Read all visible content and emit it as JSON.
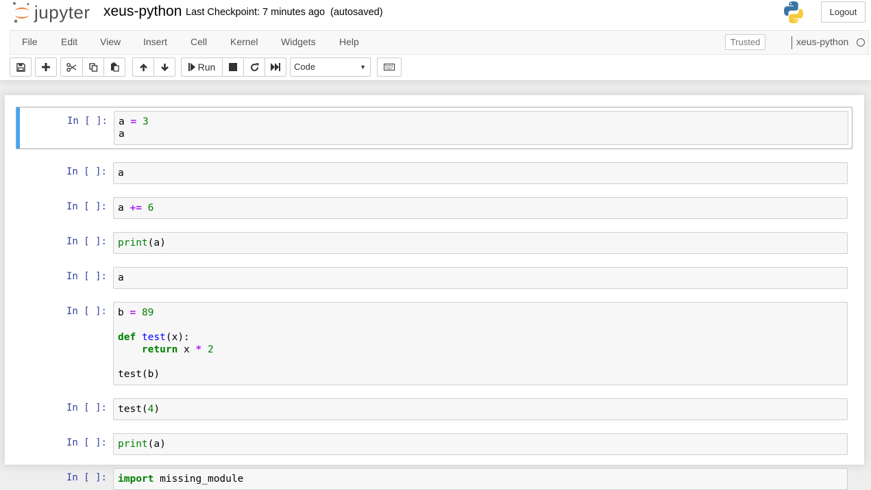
{
  "header": {
    "logo_text": "jupyter",
    "notebook_name": "xeus-python",
    "checkpoint": "Last Checkpoint: 7 minutes ago",
    "autosave": "(autosaved)",
    "logout_label": "Logout"
  },
  "menubar": {
    "items": [
      "File",
      "Edit",
      "View",
      "Insert",
      "Cell",
      "Kernel",
      "Widgets",
      "Help"
    ],
    "trusted_label": "Trusted",
    "kernel_name": "xeus-python"
  },
  "toolbar": {
    "run_label": "Run",
    "cell_type": "Code"
  },
  "cells": [
    {
      "prompt": "In [ ]:",
      "lines": [
        "a = 3",
        "a"
      ],
      "selected": true
    },
    {
      "prompt": "In [ ]:",
      "lines": [
        "a"
      ]
    },
    {
      "prompt": "In [ ]:",
      "lines": [
        "a += 6"
      ]
    },
    {
      "prompt": "In [ ]:",
      "lines": [
        "print(a)"
      ]
    },
    {
      "prompt": "In [ ]:",
      "lines": [
        "a"
      ]
    },
    {
      "prompt": "In [ ]:",
      "lines": [
        "b = 89",
        "",
        "def test(x):",
        "    return x * 2",
        "",
        "test(b)"
      ]
    },
    {
      "prompt": "In [ ]:",
      "lines": [
        "test(4)"
      ]
    },
    {
      "prompt": "In [ ]:",
      "lines": [
        "print(a)"
      ]
    },
    {
      "prompt": "In [ ]:",
      "lines": [
        "import missing_module"
      ]
    }
  ],
  "colors": {
    "prompt_in": "#303f9f",
    "selected_bar": "#42a5f5",
    "keyword": "#008000",
    "operator": "#aa22ff",
    "function_name": "#0000ff"
  }
}
